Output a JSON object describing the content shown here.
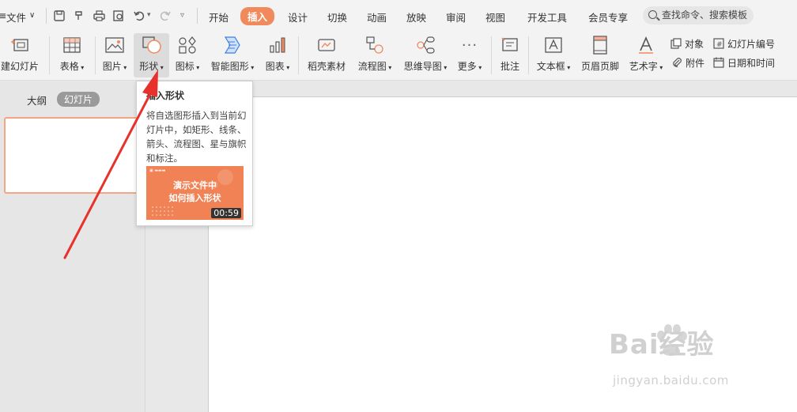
{
  "menubar": {
    "file_label": "文件",
    "tabs": [
      "开始",
      "插入",
      "设计",
      "切换",
      "动画",
      "放映",
      "审阅",
      "视图",
      "开发工具",
      "会员专享"
    ],
    "active_tab": "插入",
    "search_placeholder": "查找命令、搜索模板"
  },
  "ribbon": {
    "new_slide": "建幻灯片",
    "table": "表格",
    "picture": "图片",
    "shape": "形状",
    "icon": "图标",
    "smartart": "智能图形",
    "chart": "图表",
    "material": "稻壳素材",
    "flowchart": "流程图",
    "mindmap": "思维导图",
    "more": "更多",
    "comment": "批注",
    "textbox": "文本框",
    "header_footer": "页眉页脚",
    "wordart": "艺术字",
    "object": "对象",
    "slide_number": "幻灯片编号",
    "attachment": "附件",
    "datetime": "日期和时间"
  },
  "panel": {
    "outline_tab": "大纲",
    "slides_tab": "幻灯片"
  },
  "tooltip": {
    "title": "插入形状",
    "description": "将自选图形插入到当前幻灯片中，如矩形、线条、箭头、流程图、星与旗帜和标注。",
    "video_title_1": "演示文件中",
    "video_title_2": "如何插入形状",
    "video_duration": "00:59"
  },
  "watermark": {
    "brand": "Bai经验",
    "url": "jingyan.baidu.com"
  },
  "colors": {
    "accent": "#f08a5d",
    "arrow": "#e8312a"
  }
}
